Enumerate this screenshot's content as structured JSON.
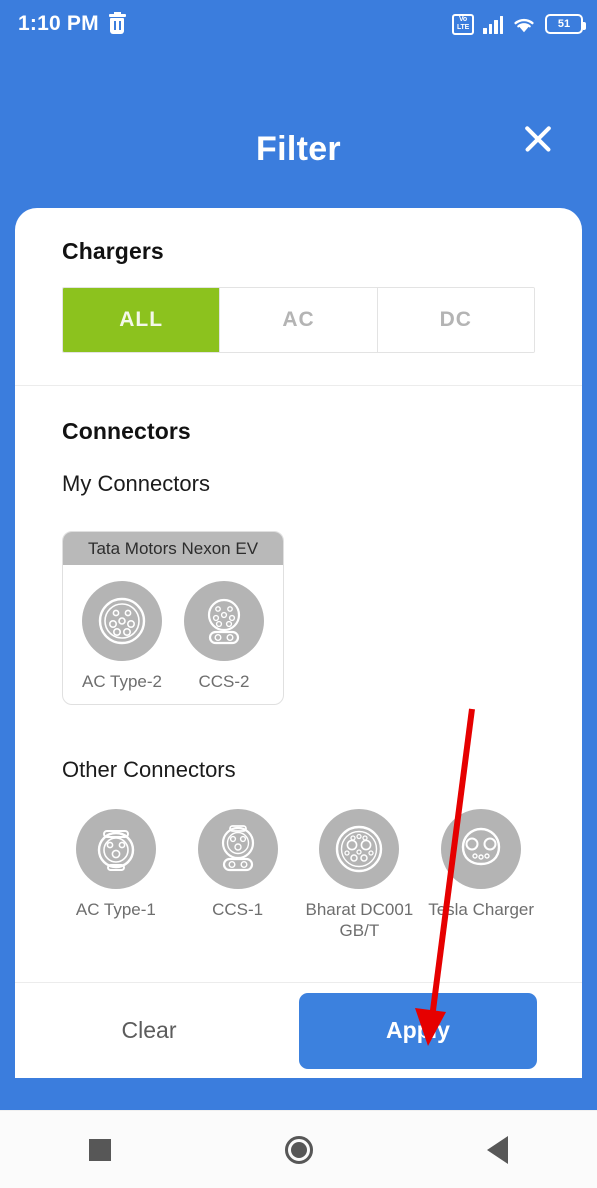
{
  "status_bar": {
    "clock": "1:10 PM",
    "trash_icon": "trash-icon",
    "volte_top": "Vo",
    "volte_bottom": "LTE",
    "signal_icon": "signal-bars-icon",
    "wifi_icon": "wifi-icon",
    "battery_level": "51"
  },
  "header": {
    "title": "Filter",
    "close_icon": "close-icon",
    "background_color": "#3b7ddd"
  },
  "chargers": {
    "title": "Chargers",
    "options": [
      {
        "label": "ALL",
        "selected": true
      },
      {
        "label": "AC",
        "selected": false
      },
      {
        "label": "DC",
        "selected": false
      }
    ],
    "selected_color": "#8cc21e"
  },
  "connectors": {
    "title": "Connectors",
    "my_connectors_label": "My Connectors",
    "vehicle": {
      "name": "Tata Motors Nexon EV",
      "connectors": [
        {
          "label": "AC Type-2",
          "icon": "ac-type-2-connector-icon"
        },
        {
          "label": "CCS-2",
          "icon": "ccs-2-connector-icon"
        }
      ]
    },
    "other_connectors_label": "Other Connectors",
    "other": [
      {
        "label": "AC Type-1",
        "icon": "ac-type-1-connector-icon"
      },
      {
        "label": "CCS-1",
        "icon": "ccs-1-connector-icon"
      },
      {
        "label": "Bharat DC001 GB/T",
        "icon": "bharat-dc001-connector-icon"
      },
      {
        "label": "Tesla Charger",
        "icon": "tesla-charger-connector-icon"
      }
    ]
  },
  "footer": {
    "clear_label": "Clear",
    "apply_label": "Apply",
    "apply_color": "#3c81de"
  },
  "navbar": {
    "recents_icon": "square-recents-icon",
    "home_icon": "circle-home-icon",
    "back_icon": "triangle-back-icon"
  },
  "annotation": {
    "arrow_color": "#e60000",
    "points_to": "Apply"
  }
}
